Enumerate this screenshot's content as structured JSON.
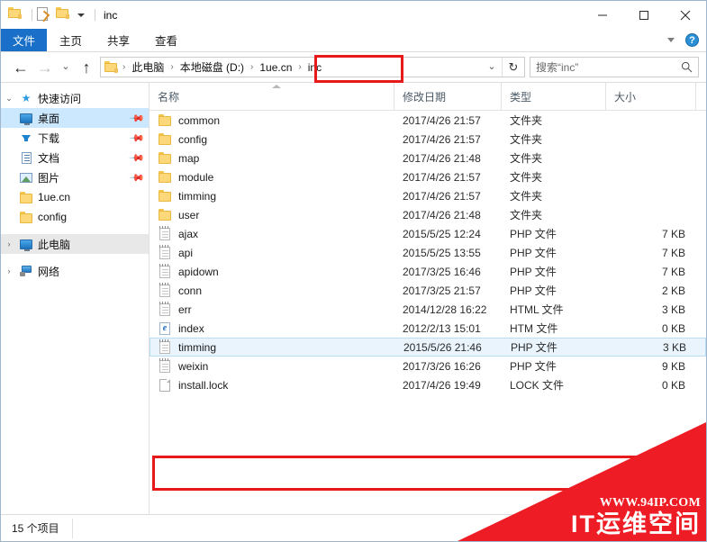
{
  "window": {
    "title": "inc",
    "quick_access": [
      {
        "icon": "folder-icon",
        "name": "qat-folder"
      },
      {
        "icon": "properties-icon",
        "name": "qat-properties"
      },
      {
        "icon": "new-folder-icon",
        "name": "qat-new-folder"
      },
      {
        "icon": "chevron-down-icon",
        "name": "qat-customize"
      }
    ],
    "controls": {
      "minimize": "minimize-icon",
      "maximize": "maximize-icon",
      "close": "close-icon"
    }
  },
  "ribbon": {
    "tabs": [
      {
        "label": "文件",
        "active": true
      },
      {
        "label": "主页",
        "active": false
      },
      {
        "label": "共享",
        "active": false
      },
      {
        "label": "查看",
        "active": false
      }
    ],
    "collapse_icon": "chevron-down-icon",
    "help_icon": "help-icon",
    "help_label": "?"
  },
  "navbar": {
    "back_icon": "arrow-left-icon",
    "forward_icon": "arrow-right-icon",
    "recent_icon": "chevron-down-icon",
    "up_icon": "arrow-up-icon",
    "breadcrumbs": [
      {
        "label": "此电脑"
      },
      {
        "label": "本地磁盘 (D:)"
      },
      {
        "label": "1ue.cn"
      },
      {
        "label": "inc"
      }
    ],
    "separator": "›",
    "dropdown_icon": "chevron-down-icon",
    "refresh_icon": "refresh-icon",
    "refresh_glyph": "↻"
  },
  "search": {
    "value": "搜索“inc”",
    "placeholder": "搜索“inc”",
    "icon": "search-icon"
  },
  "sidebar": {
    "items": [
      {
        "label": "快速访问",
        "icon": "star-icon",
        "expander": "chevron-down-icon",
        "level": 0,
        "pinned": false,
        "selected": false,
        "group": false
      },
      {
        "label": "桌面",
        "icon": "desktop-icon",
        "expander": "",
        "level": 1,
        "pinned": true,
        "selected": true,
        "group": false
      },
      {
        "label": "下载",
        "icon": "download-icon",
        "expander": "",
        "level": 1,
        "pinned": true,
        "selected": false,
        "group": false
      },
      {
        "label": "文档",
        "icon": "documents-icon",
        "expander": "",
        "level": 1,
        "pinned": true,
        "selected": false,
        "group": false
      },
      {
        "label": "图片",
        "icon": "pictures-icon",
        "expander": "",
        "level": 1,
        "pinned": true,
        "selected": false,
        "group": false
      },
      {
        "label": "1ue.cn",
        "icon": "folder-icon",
        "expander": "",
        "level": 1,
        "pinned": false,
        "selected": false,
        "group": false
      },
      {
        "label": "config",
        "icon": "folder-icon",
        "expander": "",
        "level": 1,
        "pinned": false,
        "selected": false,
        "group": false
      },
      {
        "label": "此电脑",
        "icon": "this-pc-icon",
        "expander": "chevron-right-icon",
        "level": 0,
        "pinned": false,
        "selected": false,
        "group": true
      },
      {
        "label": "网络",
        "icon": "network-icon",
        "expander": "chevron-right-icon",
        "level": 0,
        "pinned": false,
        "selected": false,
        "group": false
      }
    ]
  },
  "filelist": {
    "columns": [
      {
        "label": "名称",
        "key": "name"
      },
      {
        "label": "修改日期",
        "key": "date"
      },
      {
        "label": "类型",
        "key": "type"
      },
      {
        "label": "大小",
        "key": "size"
      }
    ],
    "sort_indicator": "sort-ascending-icon",
    "rows": [
      {
        "name": "common",
        "date": "2017/4/26 21:57",
        "type": "文件夹",
        "size": "",
        "icon": "folder-icon",
        "hover": false
      },
      {
        "name": "config",
        "date": "2017/4/26 21:57",
        "type": "文件夹",
        "size": "",
        "icon": "folder-icon",
        "hover": false
      },
      {
        "name": "map",
        "date": "2017/4/26 21:48",
        "type": "文件夹",
        "size": "",
        "icon": "folder-icon",
        "hover": false
      },
      {
        "name": "module",
        "date": "2017/4/26 21:57",
        "type": "文件夹",
        "size": "",
        "icon": "folder-icon",
        "hover": false
      },
      {
        "name": "timming",
        "date": "2017/4/26 21:57",
        "type": "文件夹",
        "size": "",
        "icon": "folder-icon",
        "hover": false
      },
      {
        "name": "user",
        "date": "2017/4/26 21:48",
        "type": "文件夹",
        "size": "",
        "icon": "folder-icon",
        "hover": false
      },
      {
        "name": "ajax",
        "date": "2015/5/25 12:24",
        "type": "PHP 文件",
        "size": "7 KB",
        "icon": "php-file-icon",
        "hover": false
      },
      {
        "name": "api",
        "date": "2015/5/25 13:55",
        "type": "PHP 文件",
        "size": "7 KB",
        "icon": "php-file-icon",
        "hover": false
      },
      {
        "name": "apidown",
        "date": "2017/3/25 16:46",
        "type": "PHP 文件",
        "size": "7 KB",
        "icon": "php-file-icon",
        "hover": false
      },
      {
        "name": "conn",
        "date": "2017/3/25 21:57",
        "type": "PHP 文件",
        "size": "2 KB",
        "icon": "php-file-icon",
        "hover": false
      },
      {
        "name": "err",
        "date": "2014/12/28 16:22",
        "type": "HTML 文件",
        "size": "3 KB",
        "icon": "php-file-icon",
        "hover": false
      },
      {
        "name": "index",
        "date": "2012/2/13 15:01",
        "type": "HTM 文件",
        "size": "0 KB",
        "icon": "ie-file-icon",
        "hover": false
      },
      {
        "name": "timming",
        "date": "2015/5/26 21:46",
        "type": "PHP 文件",
        "size": "3 KB",
        "icon": "php-file-icon",
        "hover": true
      },
      {
        "name": "weixin",
        "date": "2017/3/26 16:26",
        "type": "PHP 文件",
        "size": "9 KB",
        "icon": "php-file-icon",
        "hover": false
      },
      {
        "name": "install.lock",
        "date": "2017/4/26 19:49",
        "type": "LOCK 文件",
        "size": "0 KB",
        "icon": "blank-file-icon",
        "hover": false
      }
    ]
  },
  "statusbar": {
    "item_count": "15 个项目"
  },
  "annotations": [
    {
      "name": "breadcrumb-highlight",
      "target": "inc"
    },
    {
      "name": "install-lock-highlight",
      "target": "install.lock"
    }
  ],
  "watermark": {
    "url": "WWW.94IP.COM",
    "brand": "IT运维空间"
  },
  "colors": {
    "accent": "#1a70c8",
    "annotation": "#e8191a",
    "watermark": "#ee1c24",
    "selection": "#cce8ff",
    "hover": "#e9f4fd"
  }
}
